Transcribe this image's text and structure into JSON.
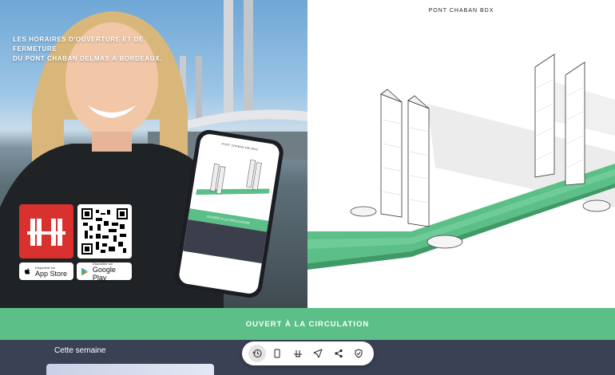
{
  "promo": {
    "tagline_line1": "LES HORAIRES D'OUVERTURE ET DE FERMETURE",
    "tagline_line2": "DU PONT CHABAN DELMAS À BORDEAUX.",
    "app_store": {
      "small": "Disponible sur",
      "big": "App Store"
    },
    "google_play": {
      "small": "Disponible sur",
      "big": "Google Play"
    },
    "phone": {
      "title": "PONT CHABAN DELMAS",
      "status": "OUVERT À LA CIRCULATION"
    }
  },
  "illustration": {
    "title": "PONT CHABAN BDX"
  },
  "status": {
    "text": "OUVERT À LA CIRCULATION",
    "color": "#5cbf88"
  },
  "week": {
    "label": "Cette semaine"
  },
  "toolbar": {
    "items": [
      {
        "icon": "history-icon",
        "active": true
      },
      {
        "icon": "phone-icon",
        "active": false
      },
      {
        "icon": "bridge-icon",
        "active": false
      },
      {
        "icon": "navigate-icon",
        "active": false
      },
      {
        "icon": "share-icon",
        "active": false
      },
      {
        "icon": "shield-check-icon",
        "active": false
      }
    ]
  }
}
